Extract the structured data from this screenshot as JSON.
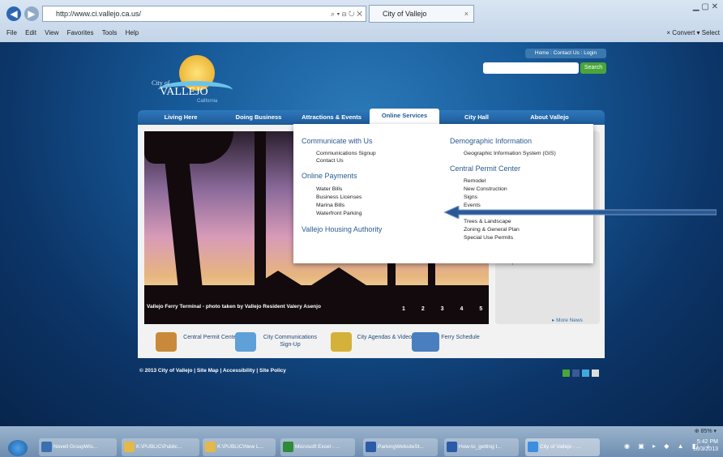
{
  "browser": {
    "url": "http://www.ci.vallejo.ca.us/",
    "address_controls": "⌕ ▾ ⊟ ↻ ✕",
    "tab_title": "City of Vallejo",
    "menu": [
      "File",
      "Edit",
      "View",
      "Favorites",
      "Tools",
      "Help"
    ],
    "menu_right": "× Convert ▾ Select"
  },
  "site": {
    "logo_city": "City of",
    "logo_name": "VALLEJO",
    "logo_state": "California",
    "top_links": "Home : Contact Us : Login",
    "search_button": "Search",
    "nav": [
      "Living Here",
      "Doing Business",
      "Attractions & Events",
      "Online Services",
      "City Hall",
      "About Vallejo"
    ],
    "active_nav": "Online Services",
    "photo_caption": "Vallejo Ferry Terminal - photo taken by Vallejo Resident Valery Asenjo",
    "slides": "1 2 3 4 5",
    "side_text": "Projects",
    "more_news": "▸ More News",
    "quick_links": [
      {
        "label": "Central Permit Center",
        "color": "#c88a3a"
      },
      {
        "label": "City Communications Sign-Up",
        "color": "#5fa0d8"
      },
      {
        "label": "City Agendas & Videos",
        "color": "#d4b23a"
      },
      {
        "label": "Ferry Schedule",
        "color": "#4a7fbf"
      }
    ],
    "footer": "© 2013 City of Vallejo | Site Map | Accessibility | Site Policy"
  },
  "dropdown": {
    "col1": {
      "h1": "Communicate with Us",
      "l1": [
        "Communications Signup",
        "Contact Us"
      ],
      "h2": "Online Payments",
      "l2": [
        "Water Bills",
        "Business Licenses",
        "Marina Bills",
        "Waterfront Parking"
      ],
      "h3": "Vallejo Housing Authority"
    },
    "col2": {
      "h1": "Demographic Information",
      "l1": [
        "Geographic Information System (GIS)"
      ],
      "h2": "Central Permit Center",
      "l2": [
        "Remodel",
        "New Construction",
        "Signs",
        "Events",
        "Trees & Landscape",
        "Zoning & General Plan",
        "Special Use Permits"
      ]
    }
  },
  "taskbar": {
    "zoom": "⊕ 85% ▾",
    "items": [
      {
        "label": "Novell GroupWis...",
        "color": "#3b6fb0"
      },
      {
        "label": "K:\\PUBLIC\\Public...",
        "color": "#e3b94a"
      },
      {
        "label": "K:\\PUBLIC\\New L...",
        "color": "#e3b94a"
      },
      {
        "label": "Microsoft Excel - ...",
        "color": "#2f8a3a"
      },
      {
        "label": "ParkingWebsiteSt...",
        "color": "#2b5aa8"
      },
      {
        "label": "How-to_getting t...",
        "color": "#2b5aa8"
      },
      {
        "label": "City of Vallejo - ...",
        "color": "#3d8de0"
      }
    ],
    "time": "5:42 PM",
    "date": "10/3/2013"
  }
}
